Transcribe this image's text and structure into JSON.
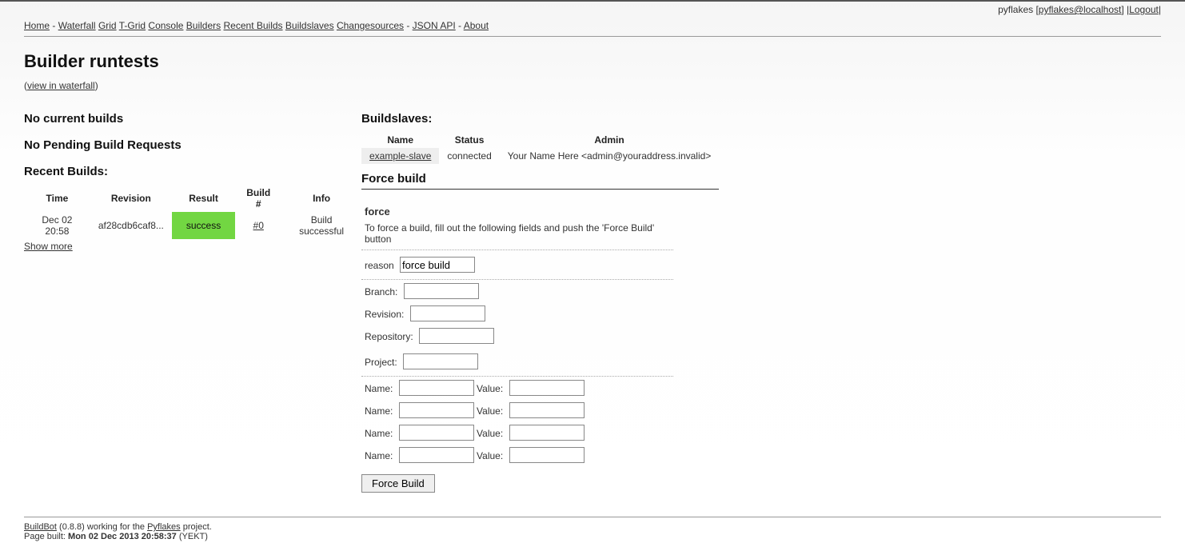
{
  "user": {
    "name": "pyflakes",
    "login": "pyflakes@localhost",
    "logout": "Logout"
  },
  "nav": {
    "home": "Home",
    "waterfall": "Waterfall",
    "grid": "Grid",
    "tgrid": "T-Grid",
    "console": "Console",
    "builders": "Builders",
    "recent_builds": "Recent Builds",
    "buildslaves": "Buildslaves",
    "changesources": "Changesources",
    "json_api": "JSON API",
    "about": "About"
  },
  "page": {
    "title": "Builder runtests",
    "view_in_waterfall": "view in waterfall"
  },
  "left": {
    "no_current": "No current builds",
    "no_pending": "No Pending Build Requests",
    "recent_heading": "Recent Builds:",
    "headers": {
      "time": "Time",
      "revision": "Revision",
      "result": "Result",
      "build": "Build #",
      "info": "Info"
    },
    "rows": [
      {
        "time": "Dec 02 20:58",
        "revision": "af28cdb6caf8...",
        "result": "success",
        "build": "#0",
        "info": "Build successful"
      }
    ],
    "show_more": "Show more"
  },
  "slaves": {
    "heading": "Buildslaves:",
    "headers": {
      "name": "Name",
      "status": "Status",
      "admin": "Admin"
    },
    "rows": [
      {
        "name": "example-slave",
        "status": "connected",
        "admin": "Your Name Here <admin@youraddress.invalid>"
      }
    ]
  },
  "force": {
    "heading": "Force build",
    "section_title": "force",
    "desc": "To force a build, fill out the following fields and push the 'Force Build' button",
    "reason_label": "reason",
    "reason_value": "force build",
    "branch_label": "Branch:",
    "revision_label": "Revision:",
    "repository_label": "Repository:",
    "project_label": "Project:",
    "name_label": "Name:",
    "value_label": "Value:",
    "button": "Force Build"
  },
  "footer": {
    "buildbot": "BuildBot",
    "version_text": " (0.8.8) working for the ",
    "pyflakes": "Pyflakes",
    "project_suffix": " project.",
    "page_built_label": "Page built: ",
    "page_built_time": "Mon 02 Dec 2013 20:58:37",
    "tz": " (YEKT)"
  }
}
